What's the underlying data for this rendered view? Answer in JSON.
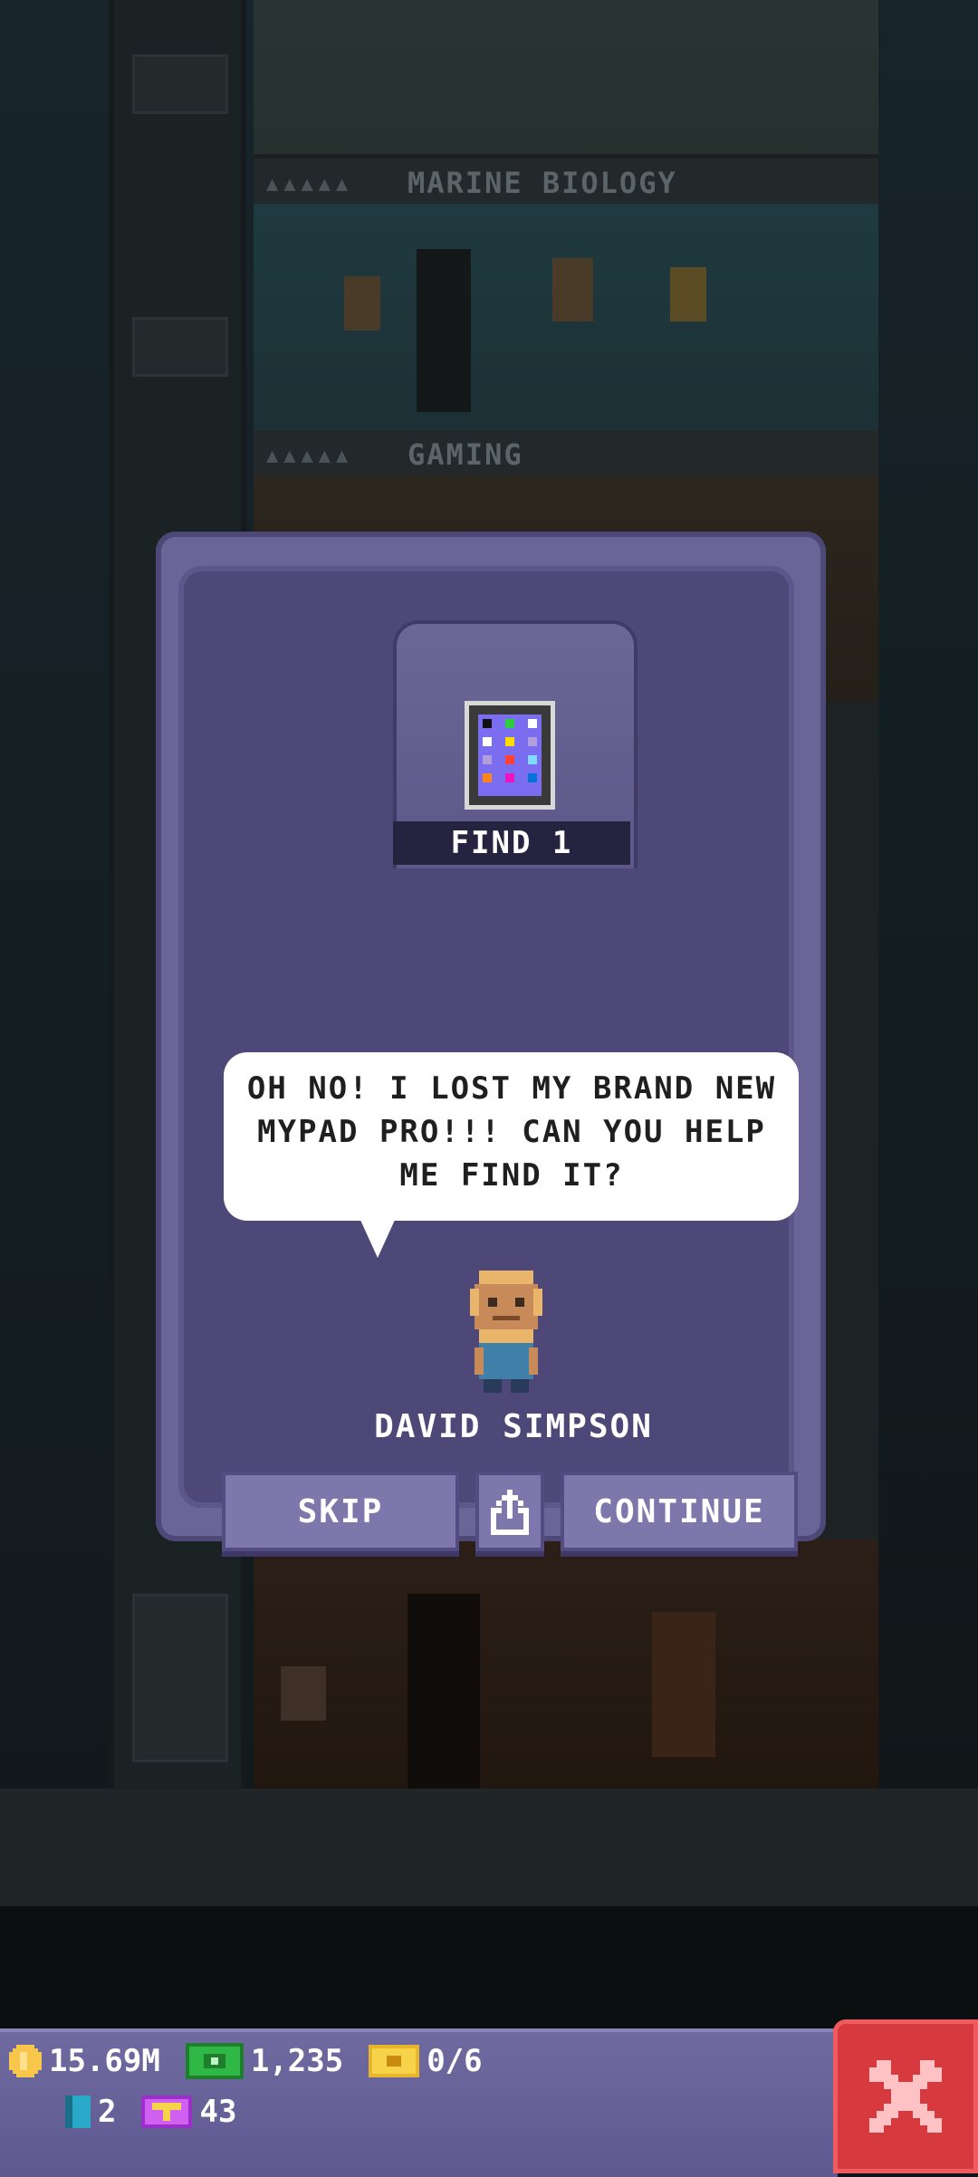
{
  "background": {
    "floors": [
      {
        "name": ""
      },
      {
        "name": "MARINE BIOLOGY"
      },
      {
        "name": "GAMING"
      }
    ]
  },
  "dialog": {
    "find_label": "FIND 1",
    "item_icon": "tablet-icon",
    "speech": "OH NO! I LOST MY BRAND NEW MYPAD PRO!!! CAN YOU HELP ME FIND IT?",
    "character_name": "DAVID SIMPSON",
    "buttons": {
      "skip": "SKIP",
      "share_icon": "share-icon",
      "continue": "CONTINUE"
    }
  },
  "hud": {
    "coins": "15.69M",
    "bux": "1,235",
    "tickets": "0/6",
    "keys": "2",
    "vip": "43",
    "close_icon": "close-icon",
    "colors": {
      "close_button": "#d63a3f",
      "panel": "#6a6497"
    }
  }
}
